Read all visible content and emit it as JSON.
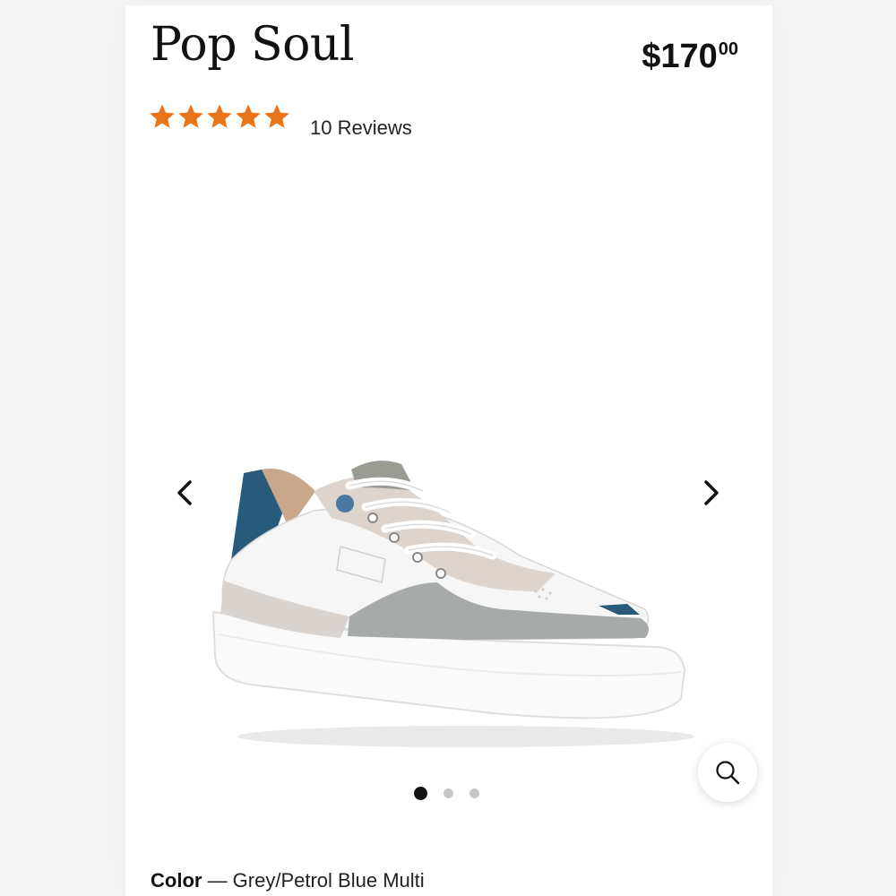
{
  "product": {
    "title": "Pop Soul",
    "price_main": "$170",
    "price_cents": "00",
    "rating": 5,
    "rating_max": 5,
    "reviews_label": "10 Reviews",
    "star_color": "#e8751a"
  },
  "gallery": {
    "prev_icon": "chevron-left-icon",
    "next_icon": "chevron-right-icon",
    "zoom_icon": "search-icon",
    "slide_count": 3,
    "active_slide": 1
  },
  "details": {
    "color_label": "Color",
    "color_value": " — Grey/Petrol Blue Multi"
  }
}
